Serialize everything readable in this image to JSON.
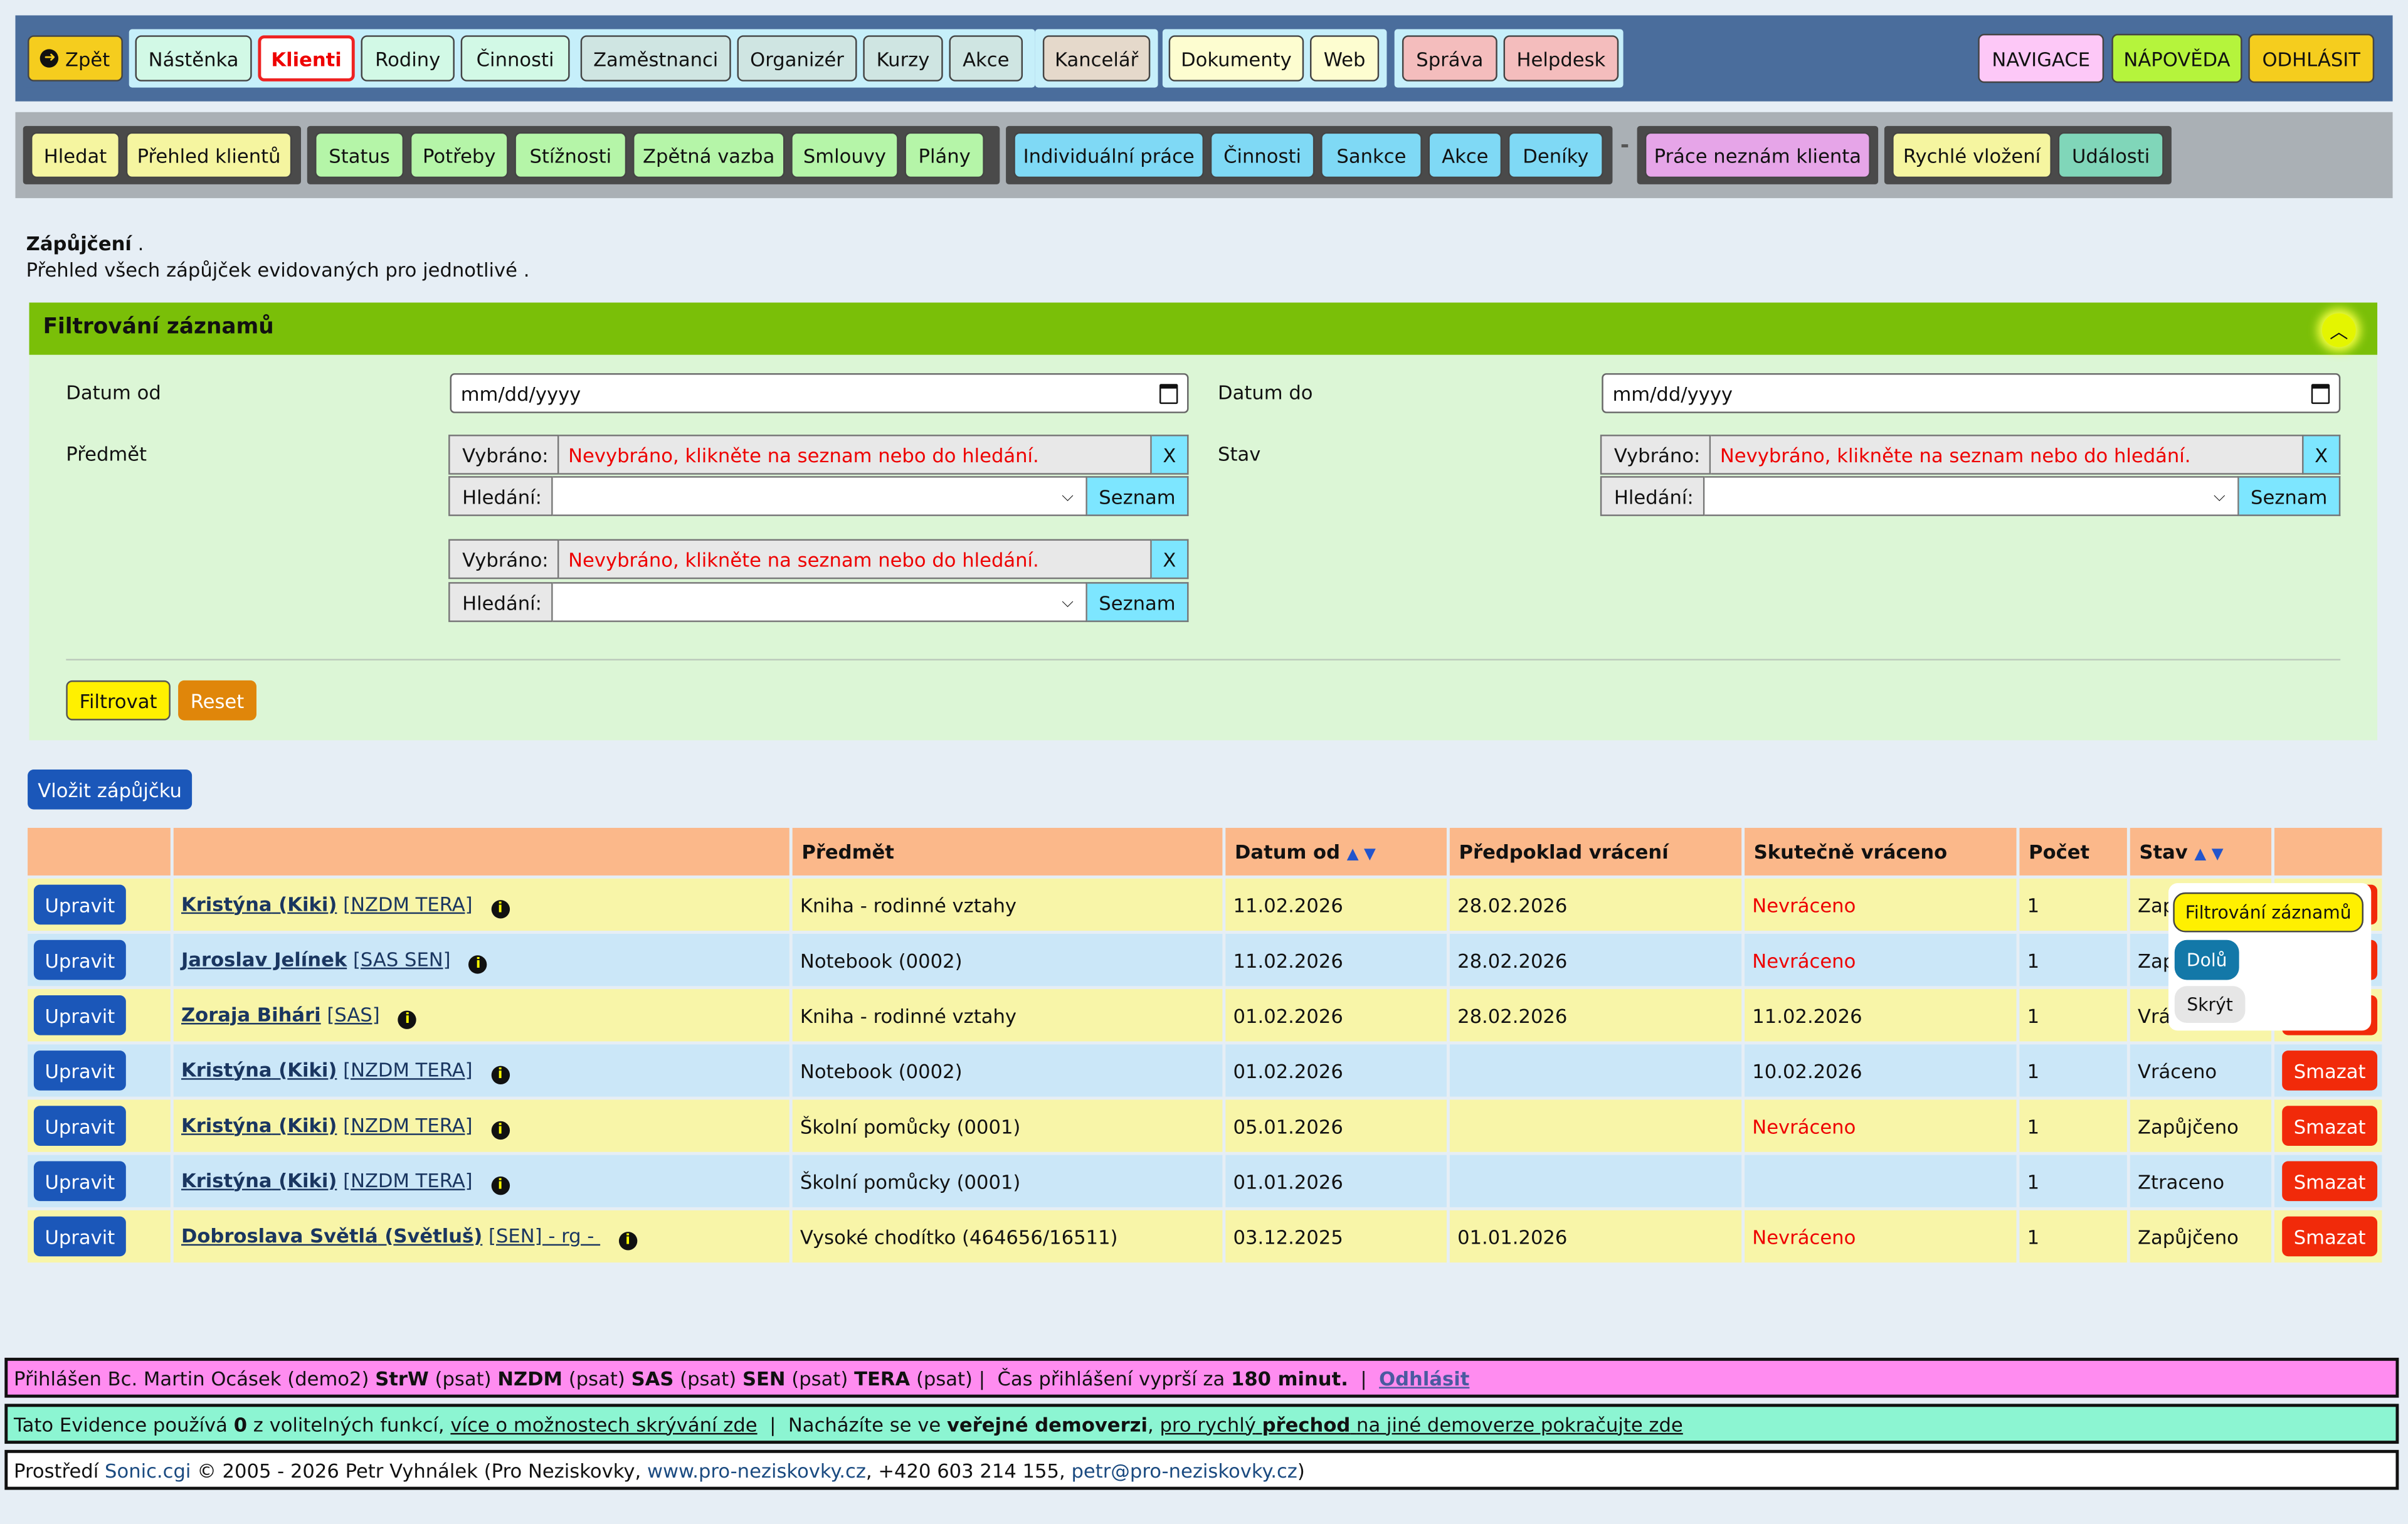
{
  "topnav": {
    "back": "Zpět",
    "items": [
      "Nástěnka",
      "Klienti",
      "Rodiny",
      "Činnosti",
      "Zaměstnanci",
      "Organizér",
      "Kurzy",
      "Akce",
      "Kancelář",
      "Dokumenty",
      "Web",
      "Správa",
      "Helpdesk"
    ],
    "right": [
      "NAVIGACE",
      "NÁPOVĚDA",
      "ODHLÁSIT"
    ]
  },
  "subnav": {
    "items": [
      "Hledat",
      "Přehled klientů",
      "Status",
      "Potřeby",
      "Stížnosti",
      "Zpětná vazba",
      "Smlouvy",
      "Plány",
      "Individuální práce",
      "Činnosti",
      "Sankce",
      "Akce",
      "Deníky",
      "Práce neznám klienta",
      "Rychlé vložení",
      "Události"
    ],
    "separator": "-"
  },
  "page": {
    "title": "Zápůjčení",
    "title_dot": " .",
    "subtitle": "Přehled všech zápůjček evidovaných pro jednotlivé ."
  },
  "filter": {
    "heading": "Filtrování záznamů",
    "date_from_label": "Datum od",
    "date_to_label": "Datum do",
    "date_placeholder": "mm/dd/yyyy",
    "subject_label": "Předmět",
    "state_label": "Stav",
    "chosen_label": "Vybráno:",
    "chosen_value": "Nevybráno, klikněte na seznam nebo do hledání.",
    "clear": "X",
    "search_label": "Hledání:",
    "list_btn": "Seznam",
    "filter_btn": "Filtrovat",
    "reset_btn": "Reset"
  },
  "insert_btn": "Vložit zápůjčku",
  "table": {
    "headers": [
      "",
      "",
      "Předmět",
      "Datum od",
      "Předpoklad vrácení",
      "Skutečně vráceno",
      "Počet",
      "Stav",
      ""
    ],
    "sort_arrows": "▲ ▼",
    "edit_label": "Upravit",
    "delete_label": "Smazat",
    "rows": [
      {
        "name": "Kristýna",
        "nick": "Kiki",
        "svc": "[NZDM TERA]",
        "item": "Kniha - rodinné vztahy",
        "from": "11.02.2026",
        "expect": "28.02.2026",
        "returned": "Nevráceno",
        "count": "1",
        "state": "Zapůjčeno"
      },
      {
        "name": "Jaroslav Jelínek",
        "nick": "",
        "svc": "[SAS SEN]",
        "item": "Notebook (0002)",
        "from": "11.02.2026",
        "expect": "28.02.2026",
        "returned": "Nevráceno",
        "count": "1",
        "state": "Zapůjčeno"
      },
      {
        "name": "Zoraja Bihári",
        "nick": "",
        "svc": "[SAS]",
        "item": "Kniha - rodinné vztahy",
        "from": "01.02.2026",
        "expect": "28.02.2026",
        "returned": "11.02.2026",
        "count": "1",
        "state": "Vráceno"
      },
      {
        "name": "Kristýna",
        "nick": "Kiki",
        "svc": "[NZDM TERA]",
        "item": "Notebook (0002)",
        "from": "01.02.2026",
        "expect": "",
        "returned": "10.02.2026",
        "count": "1",
        "state": "Vráceno"
      },
      {
        "name": "Kristýna",
        "nick": "Kiki",
        "svc": "[NZDM TERA]",
        "item": "Školní pomůcky (0001)",
        "from": "05.01.2026",
        "expect": "",
        "returned": "Nevráceno",
        "count": "1",
        "state": "Zapůjčeno"
      },
      {
        "name": "Kristýna",
        "nick": "Kiki",
        "svc": "[NZDM TERA]",
        "item": "Školní pomůcky (0001)",
        "from": "01.01.2026",
        "expect": "",
        "returned": "",
        "count": "1",
        "state": "Ztraceno"
      },
      {
        "name": "Dobroslava Světlá",
        "nick": "Světluš",
        "svc": "[SEN] - rg - ",
        "item": "Vysoké chodítko (464656/16511)",
        "from": "03.12.2025",
        "expect": "01.01.2026",
        "returned": "Nevráceno",
        "count": "1",
        "state": "Zapůjčeno"
      }
    ]
  },
  "popup": {
    "goto": "Filtrování záznamů",
    "down": "Dolů",
    "hide": "Skrýt"
  },
  "footer": {
    "login_prefix": "Přihlášen Bc. Martin Ocásek (demo2)",
    "roles": [
      {
        "code": "StrW",
        "perm": "(psat)"
      },
      {
        "code": "NZDM",
        "perm": "(psat)"
      },
      {
        "code": "SAS",
        "perm": "(psat)"
      },
      {
        "code": "SEN",
        "perm": "(psat)"
      },
      {
        "code": "TERA",
        "perm": "(psat)"
      }
    ],
    "sep": "|",
    "expire_text": "Čas přihlášení vyprší za",
    "expire_value": "180 minut.",
    "logout": "Odhlásit",
    "features_1": "Tato Evidence používá",
    "features_count": "0",
    "features_2": "z volitelných funkcí,",
    "features_link": "více o možnostech skrývání zde",
    "demo_1": "Nacházíte se ve",
    "demo_bold": "veřejné demoverzi",
    "demo_2": ",",
    "demo_link_1": "pro rychlý",
    "demo_link_bold": "přechod",
    "demo_link_2": "na jiné demoverze pokračujte zde",
    "env_1": "Prostředí",
    "env_link": "Sonic.cgi",
    "env_2": "© 2005 - 2026 Petr Vyhnálek (Pro Neziskovky,",
    "env_web": "www.pro-neziskovky.cz",
    "env_3": ", +420 603 214 155,",
    "env_mail": "petr@pro-neziskovky.cz",
    "env_4": ")"
  },
  "colors": {
    "topbar": "#4a6d9c",
    "filter_head": "#7abf08",
    "filter_body": "#dcf6d6",
    "primary_btn": "#1b57b9",
    "danger_btn": "#f12a0a",
    "row_odd": "#f8f5a8",
    "row_even": "#cbe7f8",
    "table_header": "#fbb88a",
    "footer_login": "#ff8cf0",
    "footer_info": "#8cf5d2"
  }
}
